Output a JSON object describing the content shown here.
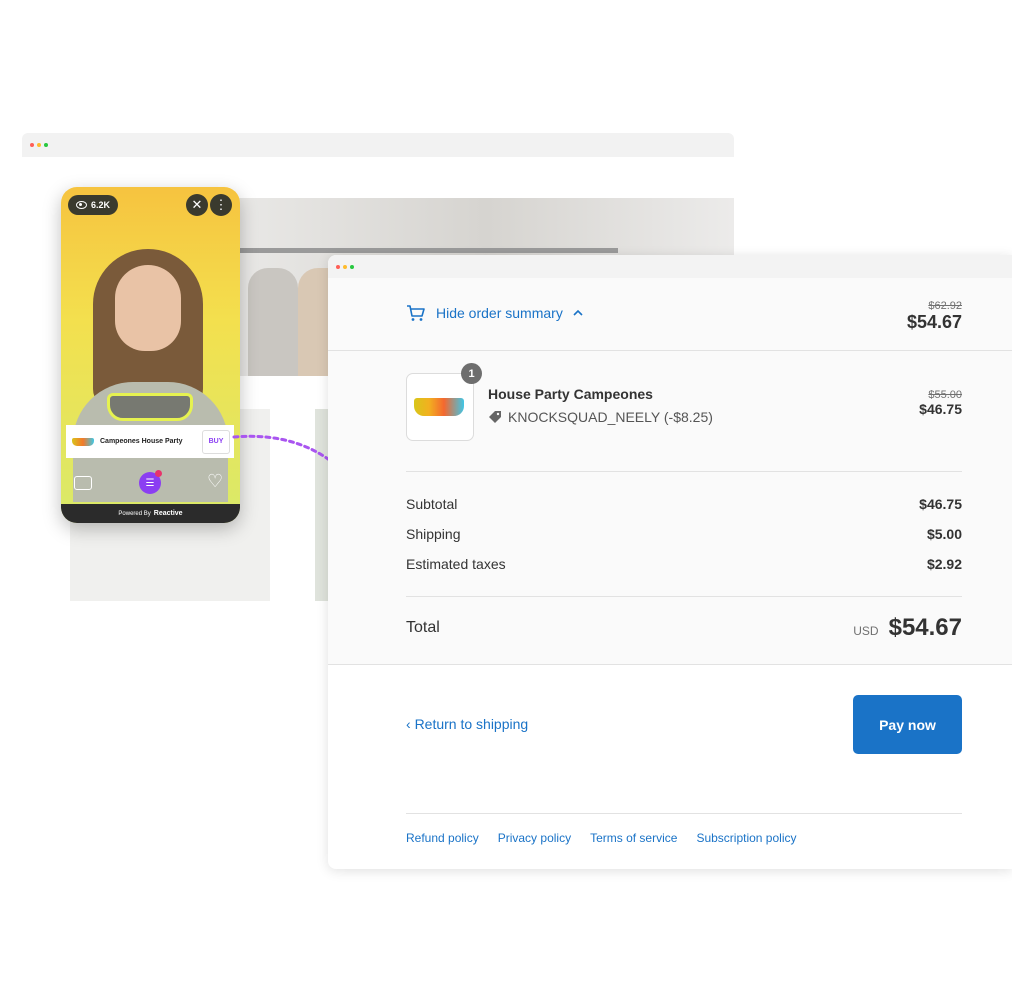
{
  "live_widget": {
    "view_count": "6.2K",
    "close_icon": "close-icon",
    "more_icon": "more-vertical-icon",
    "product_name": "Campeones House Party",
    "buy_label": "BUY",
    "powered_by": "Powered By",
    "brand": "Reactive",
    "accent_color": "#8b3ef2"
  },
  "checkout": {
    "toggle_label": "Hide order summary",
    "top_original_total": "$62.92",
    "top_total": "$54.67",
    "item": {
      "quantity": "1",
      "name": "House Party Campeones",
      "discount_code": "KNOCKSQUAD_NEELY (-$8.25)",
      "original_price": "$55.00",
      "price": "$46.75"
    },
    "subtotal_label": "Subtotal",
    "subtotal": "$46.75",
    "shipping_label": "Shipping",
    "shipping": "$5.00",
    "taxes_label": "Estimated taxes",
    "taxes": "$2.92",
    "total_label": "Total",
    "currency": "USD",
    "total": "$54.67",
    "return_label": "Return to shipping",
    "pay_label": "Pay now",
    "footer_links": [
      "Refund policy",
      "Privacy policy",
      "Terms of service",
      "Subscription policy"
    ],
    "accent_color": "#1a73c7"
  }
}
